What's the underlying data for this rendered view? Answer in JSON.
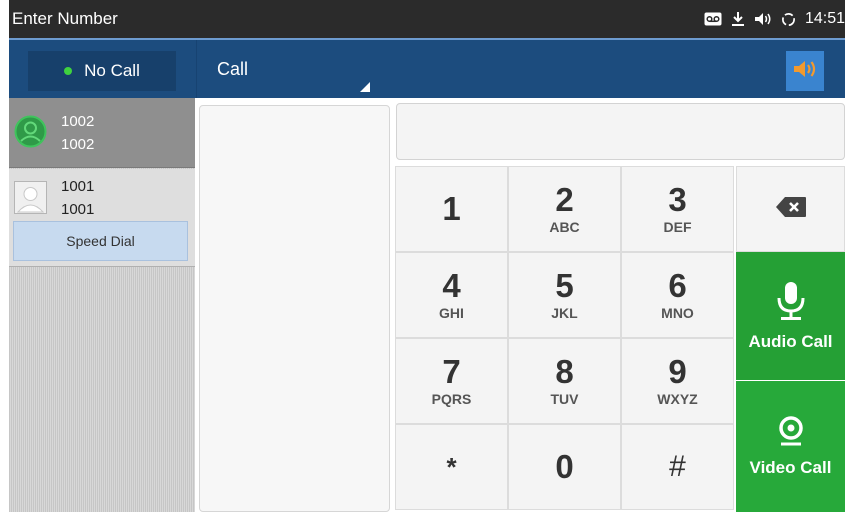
{
  "statusbar": {
    "title": "Enter Number",
    "time": "14:51",
    "icons": [
      "voicemail-icon",
      "download-icon",
      "volume-icon",
      "sync-icon"
    ]
  },
  "header": {
    "status_label": "No Call",
    "status_dot_color": "#3fd23f",
    "call_select_label": "Call",
    "speaker_icon": "speaker-icon",
    "accent_color": "#1c4c7e"
  },
  "contacts": [
    {
      "name": "1002",
      "number": "1002",
      "selected": true,
      "avatar": "contact-avatar-icon"
    },
    {
      "name": "1001",
      "number": "1001",
      "selected": false,
      "avatar": "contact-avatar-icon",
      "speed_dial_label": "Speed Dial"
    }
  ],
  "dial_input": {
    "value": ""
  },
  "keypad": [
    {
      "digit": "1",
      "letters": ""
    },
    {
      "digit": "2",
      "letters": "ABC"
    },
    {
      "digit": "3",
      "letters": "DEF"
    },
    {
      "digit": "4",
      "letters": "GHI"
    },
    {
      "digit": "5",
      "letters": "JKL"
    },
    {
      "digit": "6",
      "letters": "MNO"
    },
    {
      "digit": "7",
      "letters": "PQRS"
    },
    {
      "digit": "8",
      "letters": "TUV"
    },
    {
      "digit": "9",
      "letters": "WXYZ"
    },
    {
      "digit": "*",
      "letters": ""
    },
    {
      "digit": "0",
      "letters": ""
    },
    {
      "digit": "#",
      "letters": ""
    }
  ],
  "actions": {
    "backspace_icon": "backspace-icon",
    "audio_call_label": "Audio Call",
    "audio_call_icon": "microphone-icon",
    "video_call_label": "Video Call",
    "video_call_icon": "camera-icon",
    "call_color": "#25a035"
  }
}
